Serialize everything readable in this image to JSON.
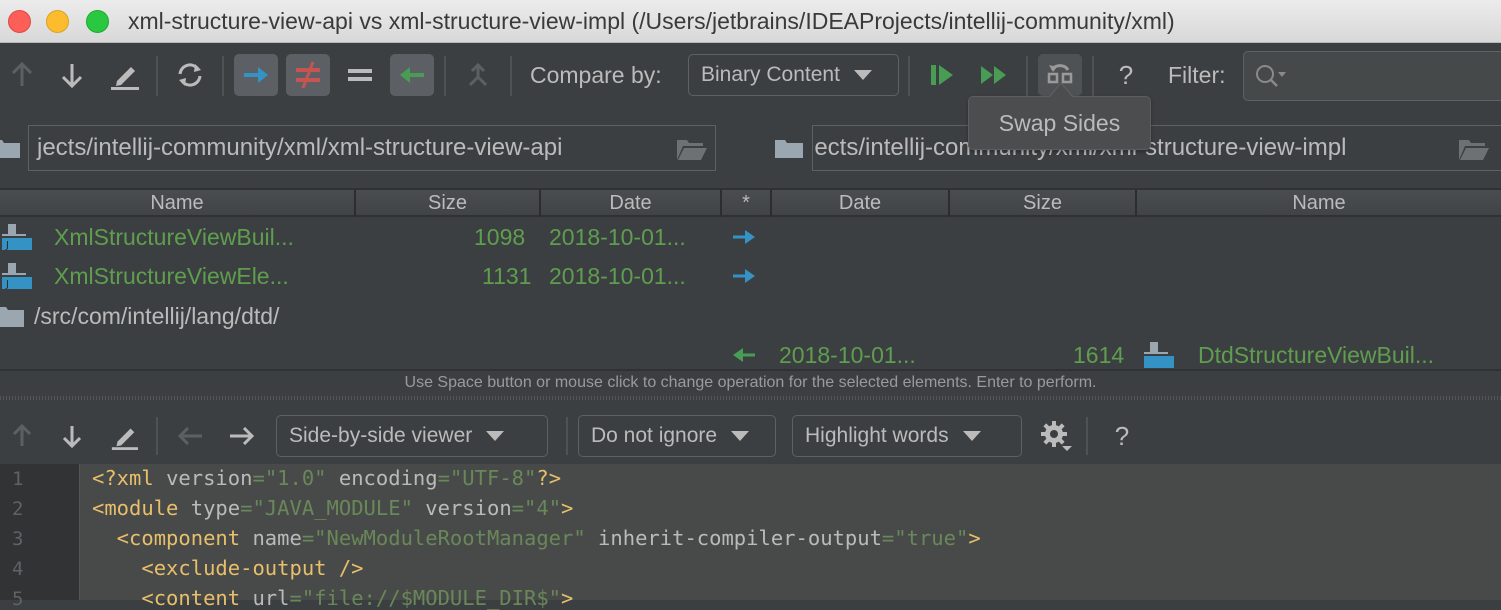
{
  "window": {
    "title": "xml-structure-view-api vs xml-structure-view-impl (/Users/jetbrains/IDEAProjects/intellij-community/xml)"
  },
  "toolbar": {
    "compare_by_label": "Compare by:",
    "compare_by_value": "Binary Content",
    "filter_label": "Filter:",
    "filter_value": "",
    "help_label": "?",
    "tooltip": "Swap Sides",
    "buttons": [
      "previous-difference",
      "next-difference",
      "edit-source",
      "refresh",
      "show-new-on-left",
      "show-different",
      "show-equal",
      "show-new-on-right",
      "merge",
      "synchronize-selected",
      "synchronize-all",
      "swap-sides",
      "help"
    ]
  },
  "paths": {
    "left": "jects/intellij-community/xml/xml-structure-view-api",
    "right": "jects/intellij-community/xml/xml-structure-view-impl"
  },
  "table": {
    "headers": {
      "left_name": "Name",
      "left_size": "Size",
      "left_date": "Date",
      "operation": "*",
      "right_date": "Date",
      "right_size": "Size",
      "right_name": "Name"
    },
    "rows": [
      {
        "left_name": "XmlStructureViewBuil...",
        "left_size": "1098",
        "left_date": "2018-10-01...",
        "operation": "copy-right",
        "right_date": "",
        "right_size": "",
        "right_name": ""
      },
      {
        "left_name": "XmlStructureViewEle...",
        "left_size": "1131",
        "left_date": "2018-10-01...",
        "operation": "copy-right",
        "right_date": "",
        "right_size": "",
        "right_name": ""
      },
      {
        "folder": "/src/com/intellij/lang/dtd/"
      },
      {
        "left_name": "",
        "left_size": "",
        "left_date": "",
        "operation": "copy-left",
        "right_date": "2018-10-01...",
        "right_size": "1614",
        "right_name": "DtdStructureViewBuil..."
      }
    ]
  },
  "status": "Use Space button or mouse click to change operation for the selected elements. Enter to perform.",
  "diff_toolbar": {
    "viewer": "Side-by-side viewer",
    "ignore": "Do not ignore",
    "highlight": "Highlight words",
    "help_label": "?"
  },
  "editor": {
    "line_numbers": [
      "1",
      "2",
      "3",
      "4",
      "5"
    ],
    "lines": [
      [
        [
          "tag",
          "<?xml "
        ],
        [
          "attr",
          "version"
        ],
        [
          "eq",
          "="
        ],
        [
          "val",
          "\"1.0\""
        ],
        [
          "attr",
          " encoding"
        ],
        [
          "eq",
          "="
        ],
        [
          "val",
          "\"UTF-8\""
        ],
        [
          "tag",
          "?>"
        ]
      ],
      [
        [
          "tag",
          "<module "
        ],
        [
          "attr",
          "type"
        ],
        [
          "eq",
          "="
        ],
        [
          "val",
          "\"JAVA_MODULE\""
        ],
        [
          "attr",
          " version"
        ],
        [
          "eq",
          "="
        ],
        [
          "val",
          "\"4\""
        ],
        [
          "tag",
          ">"
        ]
      ],
      [
        [
          "tag",
          "  <component "
        ],
        [
          "attr",
          "name"
        ],
        [
          "eq",
          "="
        ],
        [
          "val",
          "\"NewModuleRootManager\""
        ],
        [
          "attr",
          " inherit-compiler-output"
        ],
        [
          "eq",
          "="
        ],
        [
          "val",
          "\"true\""
        ],
        [
          "tag",
          ">"
        ]
      ],
      [
        [
          "tag",
          "    <exclude-output />"
        ]
      ],
      [
        [
          "tag",
          "    <content "
        ],
        [
          "attr",
          "url"
        ],
        [
          "eq",
          "="
        ],
        [
          "val",
          "\"file://$MODULE_DIR$\""
        ],
        [
          "tag",
          ">"
        ]
      ]
    ]
  },
  "colors": {
    "accent_blue": "#3592c4",
    "diff_red": "#c75450",
    "new_green": "#499c54",
    "file_green": "#5f9e4e"
  }
}
